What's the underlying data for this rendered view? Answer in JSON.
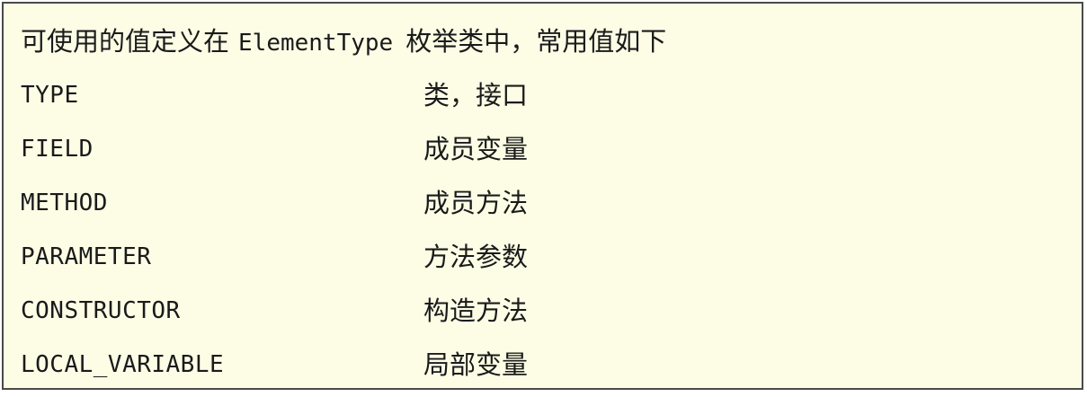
{
  "note": {
    "heading_prefix": "可使用的值定义在",
    "heading_code": "ElementType",
    "heading_suffix": "枚举类中，常用值如下",
    "rows": [
      {
        "constant": "TYPE",
        "description": "类，接口"
      },
      {
        "constant": "FIELD",
        "description": "成员变量"
      },
      {
        "constant": "METHOD",
        "description": "成员方法"
      },
      {
        "constant": "PARAMETER",
        "description": "方法参数"
      },
      {
        "constant": "CONSTRUCTOR",
        "description": "构造方法"
      },
      {
        "constant": "LOCAL_VARIABLE",
        "description": "局部变量"
      }
    ]
  },
  "colors": {
    "background": "#fdfde6",
    "border": "#4a4a4a",
    "text": "#1a1a1a"
  }
}
